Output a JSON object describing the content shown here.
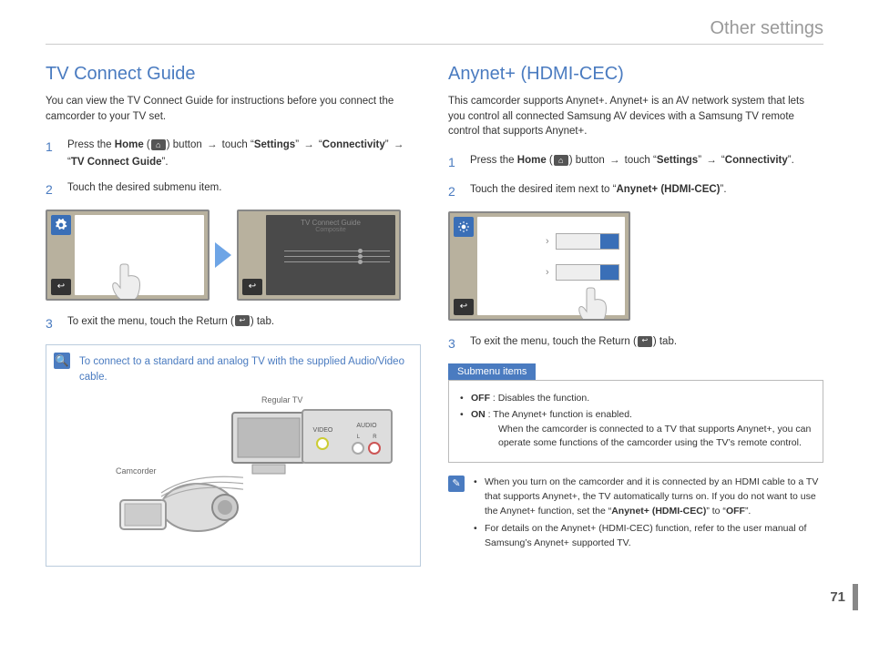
{
  "chapter_title": "Other settings",
  "page_number": "71",
  "left": {
    "heading": "TV Connect Guide",
    "intro": "You can view the TV Connect Guide for instructions before you connect the camcorder to your TV set.",
    "steps": {
      "1_pre": "Press the ",
      "1_home": "Home",
      "1_mid1": " (",
      "1_mid2": ") button ",
      "1_arrow": "→",
      "1_touch": " touch “",
      "1_settings": "Settings",
      "1_q1": "” ",
      "1_conn": "Connectivity",
      "1_tv": "TV Connect Guide",
      "2": "Touch the desired submenu item.",
      "3_pre": "To exit the menu, touch the Return (",
      "3_post": ") tab."
    },
    "tip": "To connect to a standard and analog TV with the supplied Audio/Video cable.",
    "diagram": {
      "regular_tv": "Regular TV",
      "camcorder": "Camcorder",
      "jack_video": "VIDEO",
      "jack_audio": "AUDIO",
      "jack_l": "L",
      "jack_r": "R"
    },
    "mock_dark_title": "TV Connect Guide",
    "mock_dark_sub": "Composite"
  },
  "right": {
    "heading": "Anynet+ (HDMI-CEC)",
    "intro": "This camcorder supports Anynet+. Anynet+ is an AV network system that lets you control all connected Samsung AV devices with a Samsung TV remote control that supports Anynet+.",
    "steps": {
      "1_pre": "Press the ",
      "1_home": "Home",
      "1_mid1": " (",
      "1_mid2": ") button ",
      "1_arrow": "→",
      "1_touch": " touch “",
      "1_settings": "Settings",
      "1_q1": "” ",
      "1_conn": "Connectivity",
      "1_end": "”.",
      "2_pre": "Touch the desired item next to “",
      "2_item": "Anynet+ (HDMI-CEC)",
      "2_post": "”.",
      "3_pre": "To exit the menu, touch the Return (",
      "3_post": ") tab."
    },
    "submenu_header": "Submenu items",
    "submenu": {
      "off_label": "OFF",
      "off_desc": " : Disables the function.",
      "on_label": "ON",
      "on_desc": " : The Anynet+ function is enabled.",
      "on_detail": "When the camcorder is connected to a TV that supports Anynet+, you can operate some functions of the camcorder using the TV’s remote control."
    },
    "notes": {
      "n1_a": "When you turn on the camcorder and it is connected by an HDMI cable to a TV that supports Anynet+, the TV automatically turns on. If you do not want to use the Anynet+ function, set the “",
      "n1_b": "Anynet+ (HDMI-CEC)",
      "n1_c": "” to “",
      "n1_d": "OFF",
      "n1_e": "”.",
      "n2": "For details on the Anynet+ (HDMI-CEC) function, refer to the user manual of Samsung’s Anynet+ supported TV."
    }
  }
}
